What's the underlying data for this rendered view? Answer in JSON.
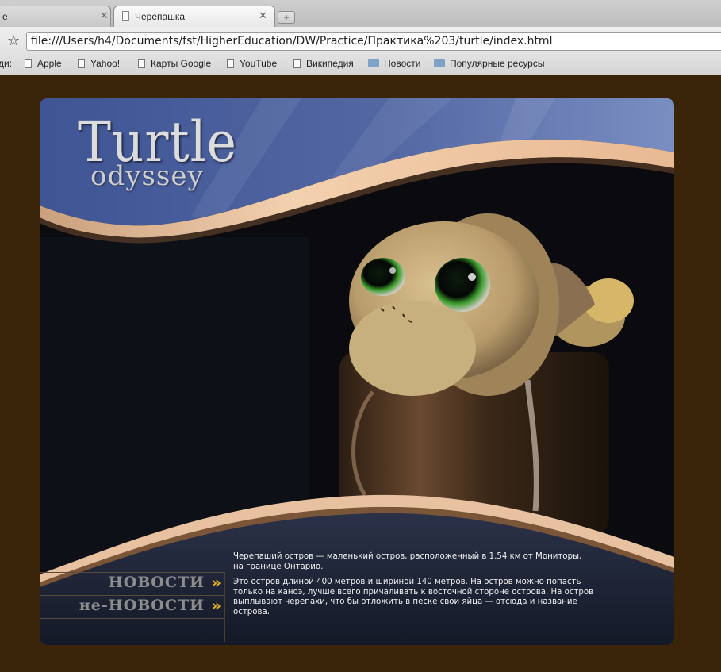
{
  "browser": {
    "tabs": [
      {
        "label": "е",
        "active": false
      },
      {
        "label": "Черепашка",
        "active": true
      }
    ],
    "url": "file:///Users/h4/Documents/fst/HigherEducation/DW/Practice/Практика%203/turtle/index.html",
    "bookmarks_prefix": "ди:",
    "bookmarks": [
      {
        "label": "Apple",
        "icon": "doc-icon"
      },
      {
        "label": "Yahoo!",
        "icon": "doc-icon"
      },
      {
        "label": "Карты Google",
        "icon": "doc-icon"
      },
      {
        "label": "YouTube",
        "icon": "doc-icon"
      },
      {
        "label": "Википедия",
        "icon": "doc-icon"
      },
      {
        "label": "Новости",
        "icon": "folder-icon"
      },
      {
        "label": "Популярные ресурсы",
        "icon": "folder-icon"
      }
    ]
  },
  "site": {
    "logo": {
      "word1": "Turtle",
      "word2": "odyssey"
    },
    "nav": [
      {
        "label": "НОВОСТИ",
        "arrow": "»"
      },
      {
        "label": "не-НОВОСТИ",
        "arrow": "»"
      }
    ],
    "content": {
      "p1_line1": "Черепаший остров — маленький остров, расположенный в 1.54 км от Мониторы,",
      "p1_line2": "на границе Онтарио.",
      "p2": "Это остров длиной 400 метров и шириной 140 метров. На остров можно попасть только на каноэ, лучше всего причаливать к восточной стороне острова. На остров выплывают черепахи, что бы отложить в песке свои яйца — отсюда и название острова."
    },
    "colors": {
      "page_background": "#3a2508",
      "header_blue": "#3e5690",
      "band_peach": "#f0c8a4",
      "footer_navy": "#1c2233",
      "nav_text": "#8d8d8d",
      "nav_arrow": "#e0b02a"
    }
  }
}
